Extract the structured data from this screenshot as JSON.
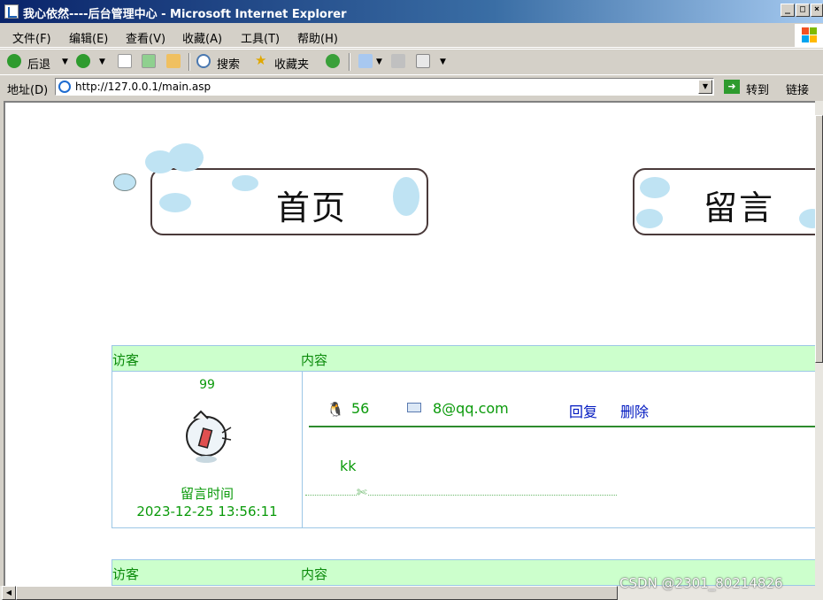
{
  "window": {
    "title": "我心依然----后台管理中心 - Microsoft Internet Explorer",
    "buttons": {
      "minimize": "_",
      "maximize": "□",
      "close": "×"
    }
  },
  "menu": [
    "文件(F)",
    "编辑(E)",
    "查看(V)",
    "收藏(A)",
    "工具(T)",
    "帮助(H)"
  ],
  "toolbar": {
    "back_label": "后退",
    "search_label": "搜索",
    "favorites_label": "收藏夹"
  },
  "address": {
    "label": "地址(D)",
    "url": "http://127.0.0.1/main.asp",
    "go_label": "转到",
    "links_label": "链接"
  },
  "nav": {
    "home_label": "首页",
    "guestbook_label": "留言"
  },
  "table_headers": {
    "visitor": "访客",
    "content": "内容"
  },
  "messages": [
    {
      "visitor_name": "99",
      "time_label": "留言时间",
      "time": "2023-12-25 13:56:11",
      "qq": "56",
      "email": "8@qq.com",
      "reply_label": "回复",
      "delete_label": "删除",
      "body": "kk"
    }
  ],
  "watermark": "CSDN @2301_80214826",
  "colors": {
    "header_bg": "#ccffcc",
    "text_green": "#0a9a0a",
    "link_blue": "#0018c0",
    "border_blue": "#9cc7e6"
  }
}
